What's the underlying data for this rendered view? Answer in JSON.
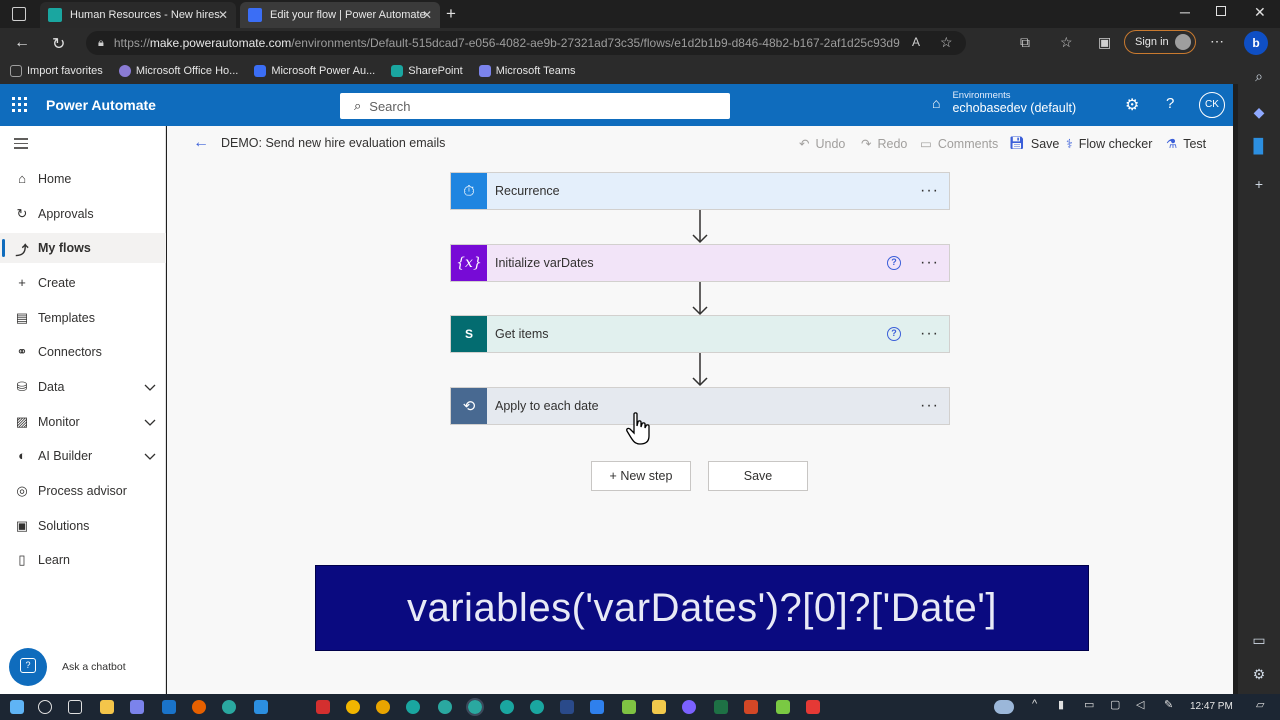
{
  "browser": {
    "tabs": [
      {
        "label": "Human Resources - New hires - /",
        "active": false
      },
      {
        "label": "Edit your flow | Power Automate",
        "active": true
      }
    ],
    "url_prefix": "https://",
    "url_host": "make.powerautomate.com",
    "url_path": "/environments/Default-515dcad7-e056-4082-ae9b-27321ad73c35/flows/e1d2b1b9-d846-48b2-b167-2af1d25c93d9",
    "sign_in_label": "Sign in",
    "bookmarks": [
      {
        "label": "Import favorites",
        "icon": "import-icon",
        "color": "#9e9e9e"
      },
      {
        "label": "Microsoft Office Ho...",
        "icon": "office-icon",
        "color": "#8a7bd4"
      },
      {
        "label": "Microsoft Power Au...",
        "icon": "power-automate-icon",
        "color": "#3b6ef5"
      },
      {
        "label": "SharePoint",
        "icon": "sharepoint-icon",
        "color": "#1aa6a0"
      },
      {
        "label": "Microsoft Teams",
        "icon": "teams-icon",
        "color": "#7b83eb"
      }
    ]
  },
  "header": {
    "brand": "Power Automate",
    "search_placeholder": "Search",
    "env_label": "Environments",
    "env_name": "echobasedev (default)",
    "avatar": "CK",
    "accent": "#0f6cbd"
  },
  "nav": {
    "items": [
      {
        "label": "Home",
        "icon": "home-icon"
      },
      {
        "label": "Approvals",
        "icon": "approvals-icon"
      },
      {
        "label": "My flows",
        "icon": "flows-icon",
        "active": true
      },
      {
        "label": "Create",
        "icon": "plus-icon"
      },
      {
        "label": "Templates",
        "icon": "templates-icon"
      },
      {
        "label": "Connectors",
        "icon": "connectors-icon"
      },
      {
        "label": "Data",
        "icon": "data-icon",
        "expandable": true
      },
      {
        "label": "Monitor",
        "icon": "monitor-icon",
        "expandable": true
      },
      {
        "label": "AI Builder",
        "icon": "ai-builder-icon",
        "expandable": true
      },
      {
        "label": "Process advisor",
        "icon": "process-advisor-icon"
      },
      {
        "label": "Solutions",
        "icon": "solutions-icon"
      },
      {
        "label": "Learn",
        "icon": "learn-icon"
      }
    ],
    "chatbot_label": "Ask a chatbot"
  },
  "command_bar": {
    "flow_title": "DEMO: Send new hire evaluation emails",
    "undo": "Undo",
    "redo": "Redo",
    "comments": "Comments",
    "save": "Save",
    "flow_checker": "Flow checker",
    "test": "Test"
  },
  "flow": {
    "steps": [
      {
        "title": "Recurrence",
        "color": "#1f85e0",
        "bg": "#e4effb",
        "icon": "clock-icon"
      },
      {
        "title": "Initialize varDates",
        "color": "#770bd6",
        "bg": "#f2e4f8",
        "icon": "variable-icon",
        "help": true
      },
      {
        "title": "Get items",
        "color": "#036c70",
        "bg": "#e1f0ee",
        "icon": "sharepoint-icon",
        "help": true
      },
      {
        "title": "Apply to each date",
        "color": "#486991",
        "bg": "#e5e9ef",
        "icon": "loop-icon"
      }
    ],
    "new_step_label": "+ New step",
    "save_label": "Save"
  },
  "overlay_text": "variables('varDates')?[0]?['Date']",
  "taskbar": {
    "time": "12:47 PM"
  }
}
